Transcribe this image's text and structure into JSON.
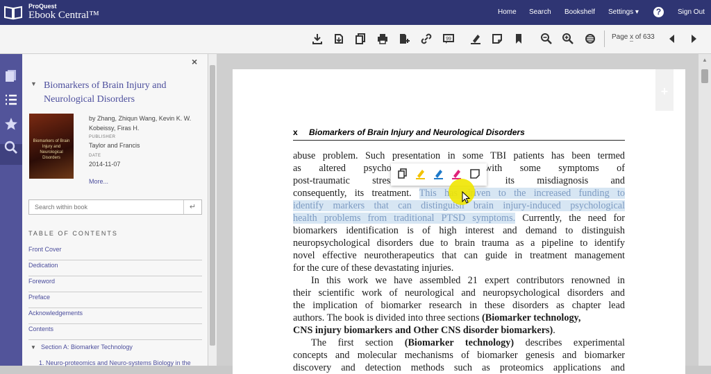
{
  "brand": {
    "small": "ProQuest",
    "big": "Ebook Central™"
  },
  "nav": {
    "home": "Home",
    "search": "Search",
    "bookshelf": "Bookshelf",
    "settings": "Settings ▾",
    "help": "?",
    "signout": "Sign Out"
  },
  "toolbar": {
    "icons": [
      "download-icon",
      "full-download-icon",
      "copy-icon",
      "print-icon",
      "add-to-bookshelf-icon",
      "link-icon",
      "cite-icon",
      "highlight-icon",
      "note-icon",
      "bookmark-icon",
      "zoom-out-icon",
      "zoom-in-icon",
      "fit-page-icon",
      "previous-page-icon",
      "next-page-icon"
    ],
    "page_prefix": "Page",
    "page_value": "x",
    "page_suffix": "of 633"
  },
  "panel": {
    "close": "×",
    "title": "Biomarkers of Brain Injury and Neurological Disorders",
    "authors": "by Zhang, Zhiqun Wang, Kevin K. W. Kobeissy, Firas H.",
    "publisher_label": "PUBLISHER",
    "publisher": "Taylor and Francis",
    "date_label": "DATE",
    "date": "2014-11-07",
    "more": "More...",
    "cover_text": "Biomarkers of Brain Injury and Neurological Disorders",
    "search_placeholder": "Search within book",
    "search_submit": "↵",
    "toc_heading": "TABLE OF CONTENTS",
    "toc": [
      "Front Cover",
      "Dedication",
      "Foreword",
      "Preface",
      "Acknowledgements",
      "Contents"
    ],
    "section_a": "Section A: Biomarker Technology",
    "section_a_first": "1. Neuro-proteomics and Neuro-systems Biology in the"
  },
  "page": {
    "running_x": "x",
    "running_title": "Biomarkers of Brain Injury and Neurological Disorders",
    "bookmark_plus": "+",
    "lines": [
      {
        "t": "abuse problem. Such presentation in some TBI patients has been termed"
      },
      {
        "t": "as altered psychological ...erlaps with some symptoms of"
      },
      {
        "t": "post-traumatic stress ...leading to its misdiagnosis and"
      },
      {
        "a": "consequently, its treatment. ",
        "h": "This has driven to the increased funding to"
      },
      {
        "h": "identify markers that can distinguish brain injury-induced psychological"
      },
      {
        "h": "health problems from traditional PTSD symptoms.",
        "b": " Currently, the need for"
      },
      {
        "t": "biomarkers identification is of high interest and demand to distinguish"
      },
      {
        "t": "neuropsychological disorders due to brain trauma as a pipeline to identify"
      },
      {
        "t": "novel effective neurotherapeutics that can guide in treatment management"
      },
      {
        "t": "for the cure of these devastating injuries."
      },
      {
        "t": "In this work we have assembled 21 expert contributors renowned in"
      },
      {
        "t": "their scientific work of neurological and neuropsychological disorders and"
      },
      {
        "t": "the implication of biomarker research in these disorders as chapter lead"
      },
      {
        "a": "authors. The book is divided into three sections ",
        "bold": "(Biomarker technology,"
      },
      {
        "bold": "CNS injury biomarkers and Other CNS disorder biomarkers)",
        "b": "."
      },
      {
        "a": "The first section ",
        "bold": "(Biomarker technology)",
        "b": " describes experimental"
      },
      {
        "t": "concepts and molecular mechanisms of biomarker genesis and biomarker"
      },
      {
        "t": "discovery and detection methods such as proteomics applications and"
      }
    ]
  },
  "popup": {
    "icons": [
      "copy-text-icon",
      "highlight-yellow-icon",
      "highlight-blue-icon",
      "highlight-pink-icon",
      "add-note-icon"
    ]
  },
  "colors": {
    "topbar": "#2f3573",
    "rail": "#52549a",
    "link": "#4b4d9c",
    "highlight_bg": "#d7e6f3",
    "highlight_text": "#7d9bc2"
  }
}
